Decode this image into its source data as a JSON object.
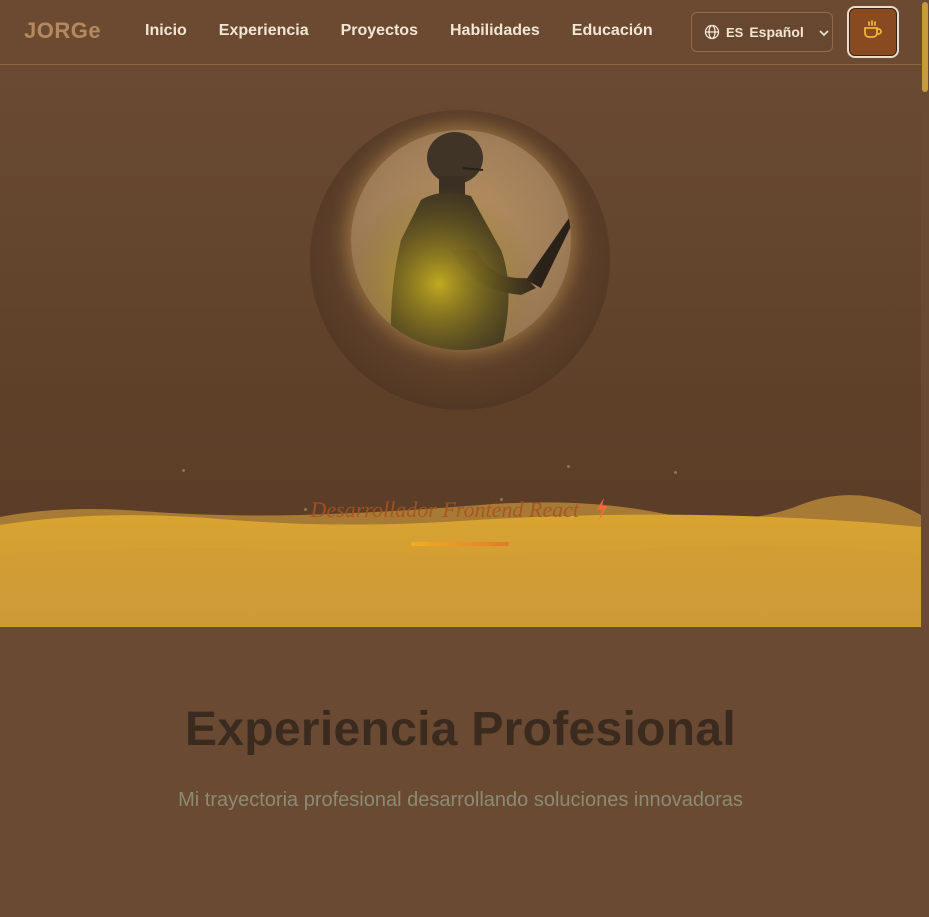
{
  "header": {
    "logo": "JORGe",
    "nav": [
      "Inicio",
      "Experiencia",
      "Proyectos",
      "Habilidades",
      "Educación"
    ],
    "language": {
      "code": "ES",
      "name": "Español",
      "icon": "globe-icon"
    },
    "theme_icon": "coffee-cup-icon"
  },
  "hero": {
    "tagline": "Desarrollador Frontend React",
    "tagline_icon": "lightning-icon",
    "avatar": "person-with-laptop-silhouette"
  },
  "experience": {
    "title": "Experiencia Profesional",
    "subtitle": "Mi trayectoria profesional desarrollando soluciones innovadoras"
  },
  "colors": {
    "background": "#6a4a33",
    "accent": "#d9a030",
    "brand": "#b58960",
    "theme_button": "#8a4a1f"
  }
}
